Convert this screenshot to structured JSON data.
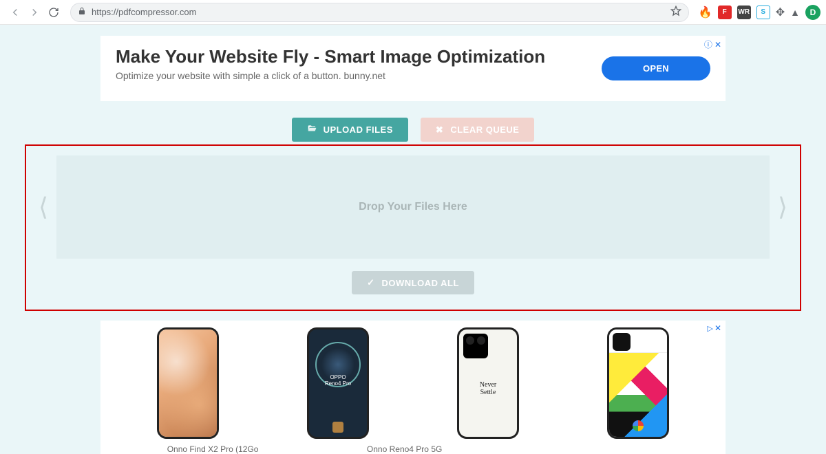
{
  "browser": {
    "url": "https://pdfcompressor.com",
    "avatar_initial": "D"
  },
  "ad_top": {
    "title": "Make Your Website Fly - Smart Image Optimization",
    "subtitle": "Optimize your website with simple a click of a button. bunny.net",
    "cta": "OPEN",
    "info_glyph": "ⓘ",
    "close_glyph": "✕"
  },
  "buttons": {
    "upload": "UPLOAD FILES",
    "clear": "CLEAR QUEUE",
    "download": "DOWNLOAD ALL"
  },
  "dropzone": {
    "label": "Drop Your Files Here"
  },
  "phone_ad": {
    "reno_label": "OPPO\nReno4 Pro",
    "never_settle": "Never\nSettle",
    "caption1": "Onno Find X2 Pro (12Go",
    "caption2": "Onno Reno4 Pro 5G",
    "ad_marker": "▷",
    "close_glyph": "✕"
  }
}
